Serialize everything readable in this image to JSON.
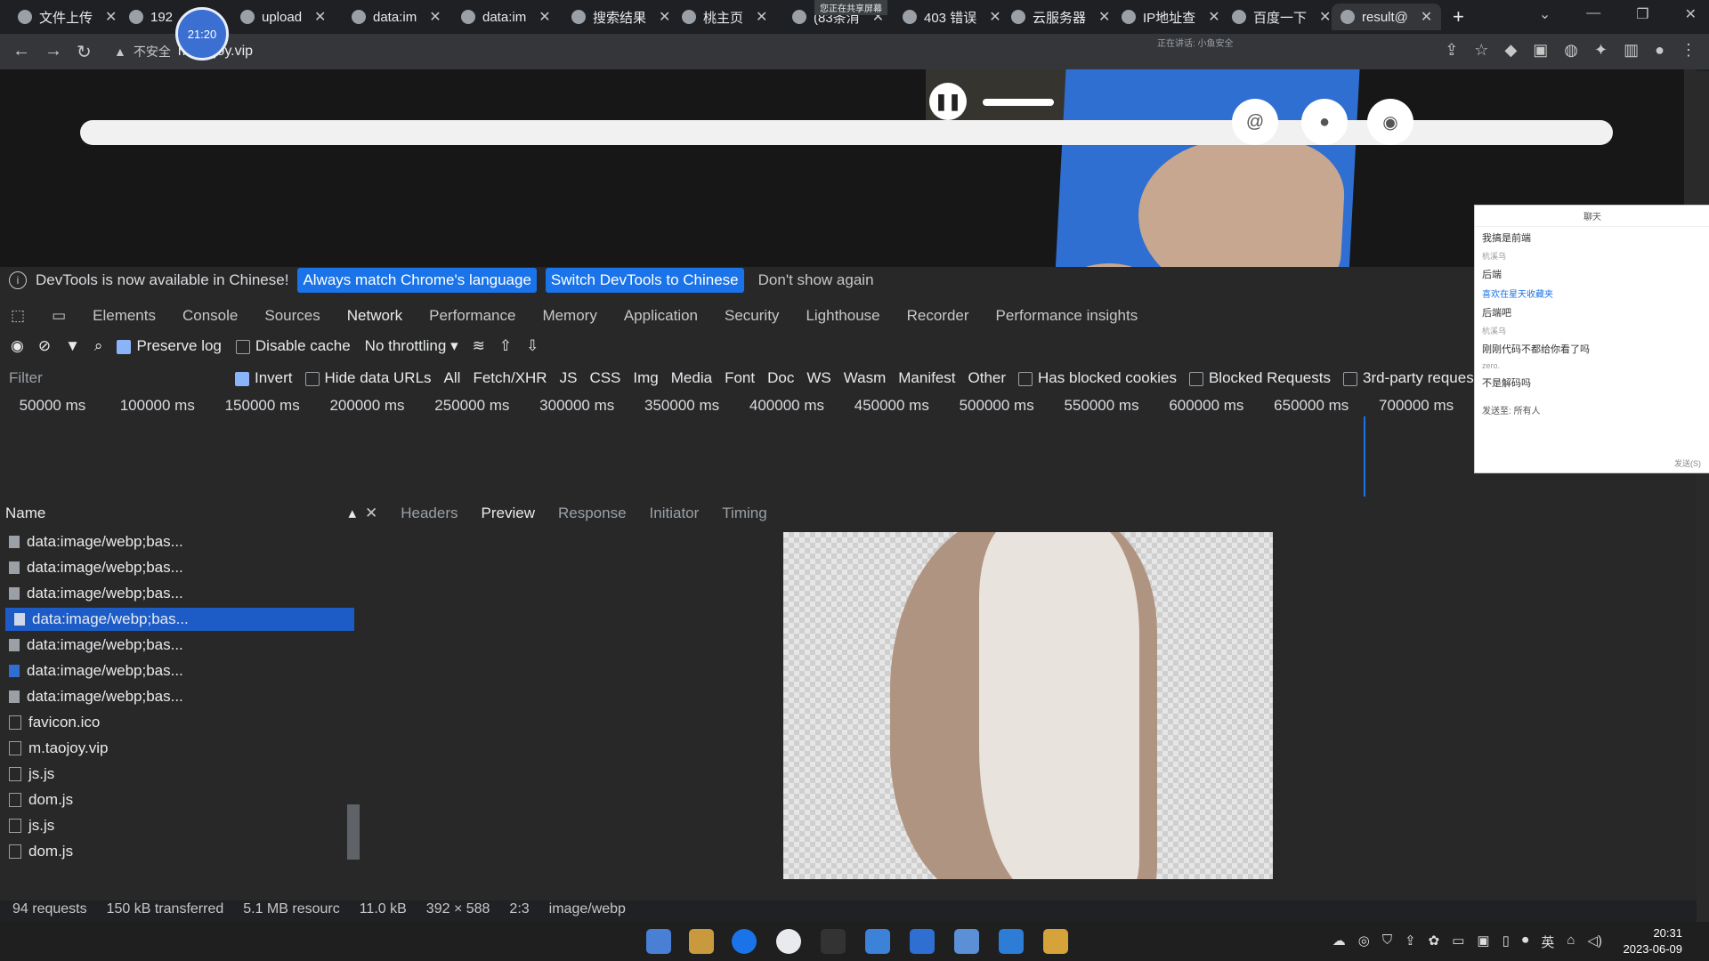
{
  "browser": {
    "tabs": [
      {
        "label": "文件上传"
      },
      {
        "label": "192"
      },
      {
        "label": "upload"
      },
      {
        "label": "data:im"
      },
      {
        "label": "data:im"
      },
      {
        "label": "搜索结果"
      },
      {
        "label": "桃主页"
      },
      {
        "label": "(83条消"
      },
      {
        "label": "403 错误"
      },
      {
        "label": "云服务器"
      },
      {
        "label": "IP地址查"
      },
      {
        "label": "百度一下"
      },
      {
        "label": "result@"
      }
    ],
    "recording_time": "21:20",
    "screen_share_label": "您正在共享屏幕",
    "sharing_status": "正在讲话: 小鱼安全",
    "security_label": "不安全",
    "url": "m.taojoy.vip"
  },
  "devtools": {
    "lang_notice": "DevTools is now available in Chinese!",
    "match_lang_button": "Always match Chrome's language",
    "switch_button": "Switch DevTools to Chinese",
    "dont_show": "Don't show again",
    "panel_tabs": [
      "Elements",
      "Console",
      "Sources",
      "Network",
      "Performance",
      "Memory",
      "Application",
      "Security",
      "Lighthouse",
      "Recorder",
      "Performance insights"
    ],
    "preserve_log": "Preserve log",
    "disable_cache": "Disable cache",
    "throttling": "No throttling",
    "filter_placeholder": "Filter",
    "invert": "Invert",
    "hide_data_urls": "Hide data URLs",
    "type_filters": [
      "All",
      "Fetch/XHR",
      "JS",
      "CSS",
      "Img",
      "Media",
      "Font",
      "Doc",
      "WS",
      "Wasm",
      "Manifest",
      "Other"
    ],
    "has_blocked_cookies": "Has blocked cookies",
    "blocked_requests": "Blocked Requests",
    "third_party": "3rd-party requests",
    "timeline_ticks": [
      "50000 ms",
      "100000 ms",
      "150000 ms",
      "200000 ms",
      "250000 ms",
      "300000 ms",
      "350000 ms",
      "400000 ms",
      "450000 ms",
      "500000 ms",
      "550000 ms",
      "600000 ms",
      "650000 ms",
      "700000 ms"
    ],
    "name_header": "Name",
    "requests": [
      {
        "name": "data:image/webp;bas..."
      },
      {
        "name": "data:image/webp;bas..."
      },
      {
        "name": "data:image/webp;bas..."
      },
      {
        "name": "data:image/webp;bas..."
      },
      {
        "name": "data:image/webp;bas..."
      },
      {
        "name": "data:image/webp;bas..."
      },
      {
        "name": "data:image/webp;bas..."
      },
      {
        "name": "favicon.ico"
      },
      {
        "name": "m.taojoy.vip"
      },
      {
        "name": "js.js"
      },
      {
        "name": "dom.js"
      },
      {
        "name": "js.js"
      },
      {
        "name": "dom.js"
      }
    ],
    "detail_tabs": [
      "Headers",
      "Preview",
      "Response",
      "Initiator",
      "Timing"
    ],
    "status": {
      "requests": "94 requests",
      "transferred": "150 kB transferred",
      "resources": "5.1 MB resourc",
      "size": "11.0 kB",
      "dimensions": "392 × 588",
      "ratio": "2:3",
      "mime": "image/webp"
    }
  },
  "chat": {
    "title": "聊天",
    "messages": [
      {
        "text": "我搞是前端",
        "muted": false
      },
      {
        "text": "杭溪乌",
        "muted": true
      },
      {
        "text": "后端",
        "muted": false
      },
      {
        "text": "喜欢在星天收藏夹",
        "muted": true
      },
      {
        "text": "后端吧",
        "muted": false
      },
      {
        "text": "杭溪乌",
        "muted": true
      },
      {
        "text": "刚刚代码不都给你看了吗",
        "muted": false
      },
      {
        "text": "zero.",
        "muted": true
      },
      {
        "text": "不是解码吗",
        "muted": false
      }
    ],
    "send_to_label": "发送至:",
    "send_to_value": "所有人",
    "send_button": "发送(S)"
  },
  "taskbar": {
    "time": "20:31",
    "date": "2023-06-09",
    "ime": "英"
  }
}
